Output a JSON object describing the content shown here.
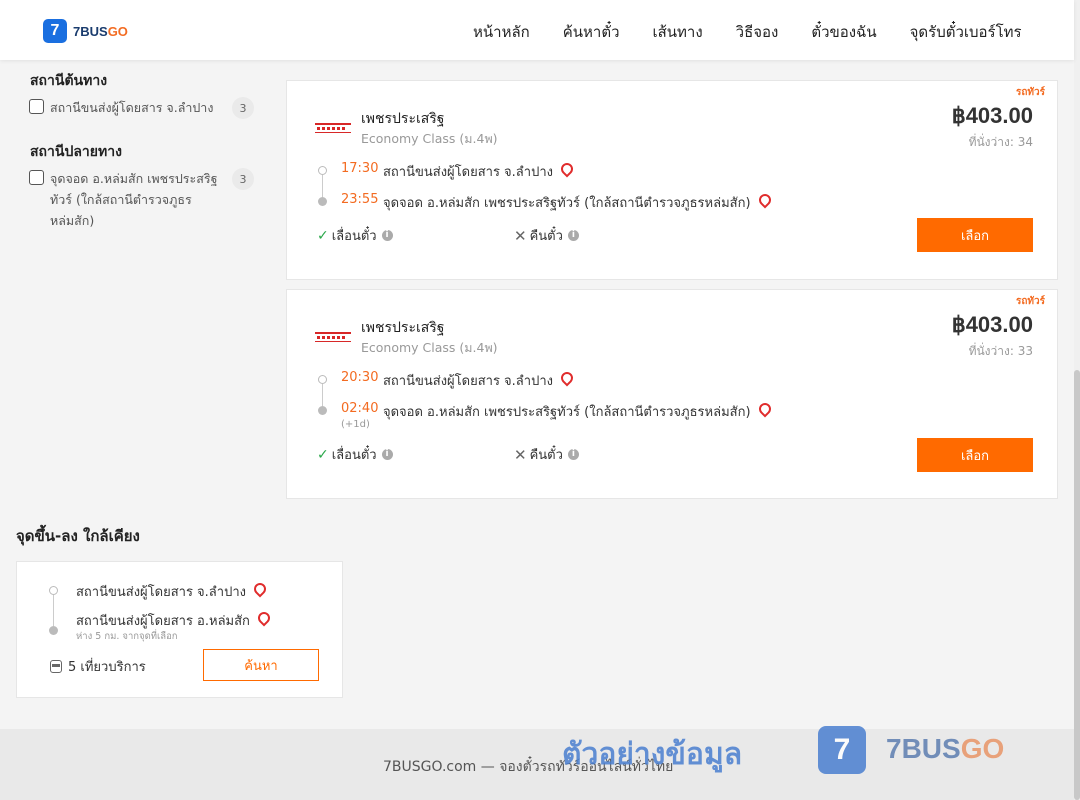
{
  "brand": {
    "logo_mark": "7",
    "name_part1": "7BUS",
    "name_part2": "GO"
  },
  "nav": [
    "หน้าหลัก",
    "ค้นหาตั๋ว",
    "เส้นทาง",
    "วิธีจอง",
    "ตั๋วของฉัน",
    "จุดรับตั๋วเบอร์โทร"
  ],
  "filters": {
    "origin_title": "สถานีต้นทาง",
    "origin_items": [
      {
        "label": "สถานีขนส่งผู้โดยสาร จ.ลำปาง",
        "count": "3"
      }
    ],
    "dest_title": "สถานีปลายทาง",
    "dest_items": [
      {
        "label": "จุดจอด อ.หล่มสัก เพชรประสริฐทัวร์ (ใกล้สถานีตำรวจภูธรหล่มสัก)",
        "count": "3"
      }
    ]
  },
  "trips": [
    {
      "tag": "รถทัวร์",
      "operator": "เพชรประเสริฐ",
      "bus_class": "Economy Class (ม.4พ)",
      "price": "฿403.00",
      "seats": "ที่นั่งว่าง: 34",
      "depart_time": "17:30",
      "depart_station": "สถานีขนส่งผู้โดยสาร จ.ลำปาง",
      "arrive_time": "23:55",
      "arrive_station": "จุดจอด อ.หล่มสัก เพชรประสริฐทัวร์ (ใกล้สถานีตำรวจภูธรหล่มสัก)",
      "next_day": "",
      "feature_reschedule": "เลื่อนตั๋ว",
      "feature_refund": "คืนตั๋ว",
      "select_label": "เลือก"
    },
    {
      "tag": "รถทัวร์",
      "operator": "เพชรประเสริฐ",
      "bus_class": "Economy Class (ม.4พ)",
      "price": "฿403.00",
      "seats": "ที่นั่งว่าง: 33",
      "depart_time": "20:30",
      "depart_station": "สถานีขนส่งผู้โดยสาร จ.ลำปาง",
      "arrive_time": "02:40",
      "arrive_station": "จุดจอด อ.หล่มสัก เพชรประสริฐทัวร์ (ใกล้สถานีตำรวจภูธรหล่มสัก)",
      "next_day": "(+1d)",
      "feature_reschedule": "เลื่อนตั๋ว",
      "feature_refund": "คืนตั๋ว",
      "select_label": "เลือก"
    }
  ],
  "nearby": {
    "title": "จุดขึ้น-ลง ใกล้เคียง",
    "from_station": "สถานีขนส่งผู้โดยสาร จ.ลำปาง",
    "to_station": "สถานีขนส่งผู้โดยสาร อ.หล่มสัก",
    "distance_note": "ห่าง 5 กม. จากจุดที่เลือก",
    "trips_count": "5 เที่ยวบริการ",
    "search_label": "ค้นหา"
  },
  "footer": {
    "text": "7BUSGO.com — จองตั๋วรถทัวร์ออนไลน์ทั่วไทย",
    "watermark_text": "ตัวอย่างข้อมูล",
    "watermark_mark": "7",
    "watermark_brand_part1": "7BUS",
    "watermark_brand_part2": "GO"
  },
  "colors": {
    "accent": "#ff6a00",
    "brand_blue": "#1a6fe0",
    "pin_red": "#e02c2c",
    "check_green": "#2aa84a"
  }
}
